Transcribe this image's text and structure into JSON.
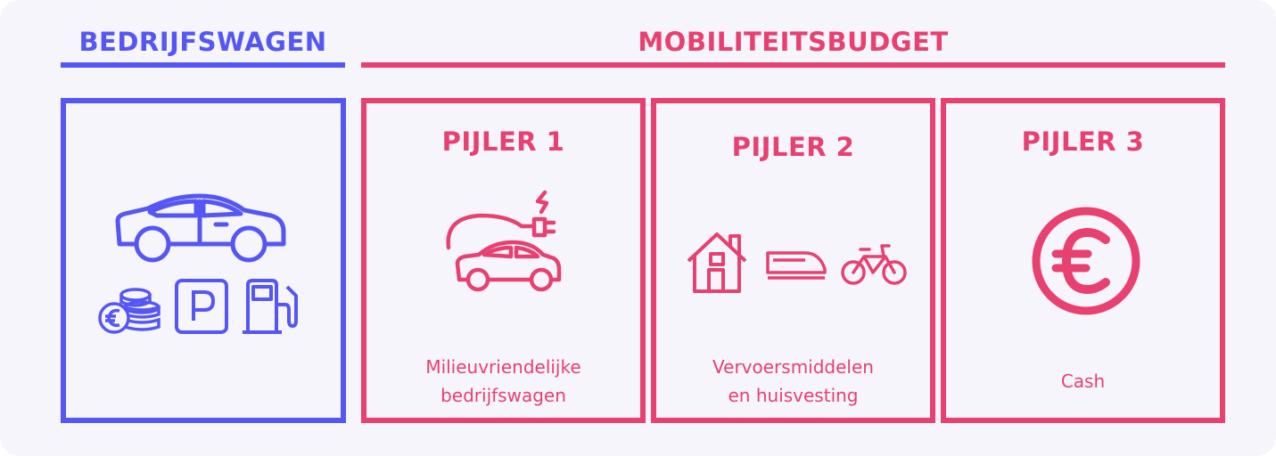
{
  "colors": {
    "blue": "#5557f5",
    "pink": "#e8406f",
    "background": "#f6f5fc"
  },
  "company_car": {
    "heading": "BEDRIJFSWAGEN",
    "icons": [
      "car-icon",
      "euro-coins-icon",
      "parking-icon",
      "fuel-pump-icon"
    ]
  },
  "mobility_budget": {
    "heading": "MOBILITEITSBUDGET",
    "pillars": [
      {
        "title": "PIJLER 1",
        "caption": [
          "Milieuvriendelijke",
          "bedrijfswagen"
        ],
        "icons": [
          "electric-car-icon"
        ]
      },
      {
        "title": "PIJLER 2",
        "caption": [
          "Vervoersmiddelen",
          "en huisvesting"
        ],
        "icons": [
          "house-icon",
          "train-icon",
          "bicycle-icon"
        ]
      },
      {
        "title": "PIJLER 3",
        "caption": [
          "Cash"
        ],
        "icons": [
          "euro-circle-icon"
        ]
      }
    ]
  }
}
